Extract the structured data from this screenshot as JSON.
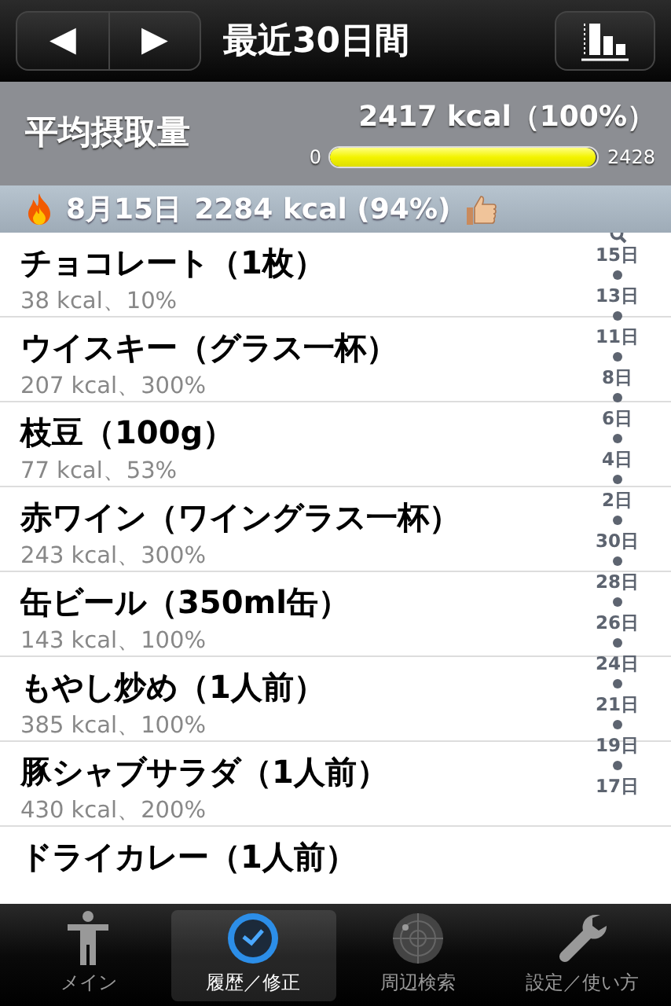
{
  "nav": {
    "title": "最近30日間",
    "prev": "◀",
    "next": "▶"
  },
  "summary": {
    "label": "平均摂取量",
    "value": "2417 kcal（100%）",
    "min": "0",
    "max": "2428",
    "level": 0.99
  },
  "section": {
    "date": "8月15日",
    "value": "2284 kcal (94%)"
  },
  "items": [
    {
      "name": "チョコレート（1枚）",
      "detail": "38 kcal、10%"
    },
    {
      "name": "ウイスキー（グラス一杯）",
      "detail": "207 kcal、300%"
    },
    {
      "name": "枝豆（100g）",
      "detail": "77 kcal、53%"
    },
    {
      "name": "赤ワイン（ワイングラス一杯）",
      "detail": "243 kcal、300%"
    },
    {
      "name": "缶ビール（350ml缶）",
      "detail": "143 kcal、100%"
    },
    {
      "name": "もやし炒め（1人前）",
      "detail": "385 kcal、100%"
    },
    {
      "name": "豚シャブサラダ（1人前）",
      "detail": "430 kcal、200%"
    },
    {
      "name": "ドライカレー（1人前）"
    }
  ],
  "index": [
    "15日",
    "13日",
    "11日",
    "8日",
    "6日",
    "4日",
    "2日",
    "30日",
    "28日",
    "26日",
    "24日",
    "21日",
    "19日",
    "17日"
  ],
  "tabs": [
    {
      "label": "メイン",
      "kind": "main",
      "selected": false
    },
    {
      "label": "履歴／修正",
      "kind": "history",
      "selected": true
    },
    {
      "label": "周辺検索",
      "kind": "nearby",
      "selected": false
    },
    {
      "label": "設定／使い方",
      "kind": "settings",
      "selected": false
    }
  ]
}
